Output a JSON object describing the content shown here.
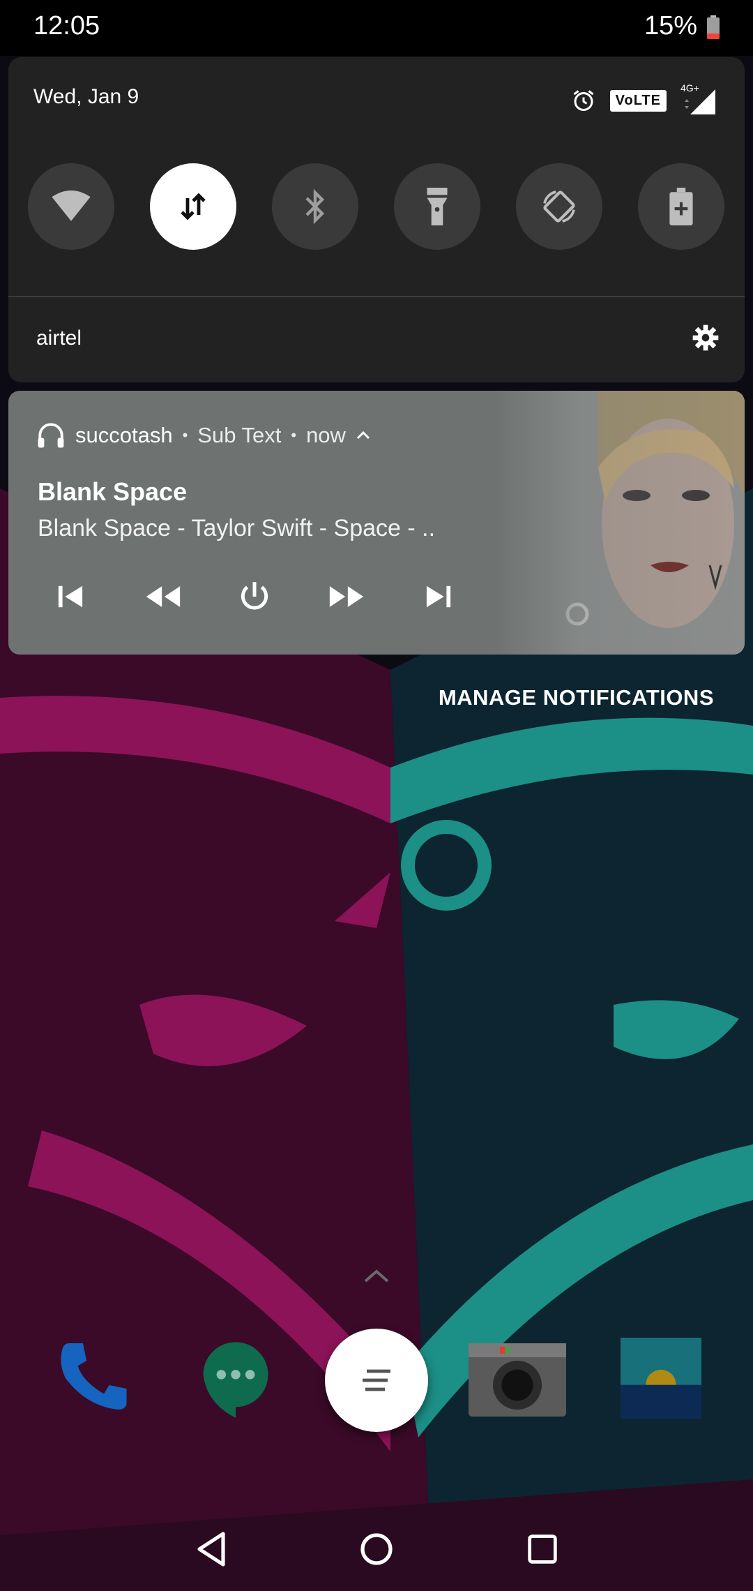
{
  "status_bar": {
    "time": "12:05",
    "battery": "15%"
  },
  "quick_settings": {
    "date": "Wed, Jan 9",
    "volte": "VoLTE",
    "network_type": "4G+",
    "tiles": [
      {
        "name": "wifi-icon",
        "active": false
      },
      {
        "name": "mobile-data-icon",
        "active": true
      },
      {
        "name": "bluetooth-icon",
        "active": false
      },
      {
        "name": "flashlight-icon",
        "active": false
      },
      {
        "name": "auto-rotate-icon",
        "active": false
      },
      {
        "name": "battery-saver-icon",
        "active": false
      }
    ],
    "carrier": "airtel"
  },
  "media_notification": {
    "app_name": "succotash",
    "sub_text": "Sub Text",
    "time": "now",
    "title": "Blank Space",
    "subtitle": "Blank Space - Taylor Swift - Space - ..",
    "controls": [
      "skip-previous-icon",
      "rewind-icon",
      "power-icon",
      "fast-forward-icon",
      "skip-next-icon"
    ]
  },
  "manage_notifications": "MANAGE NOTIFICATIONS",
  "dock": {
    "apps": [
      "phone-icon",
      "hangouts-icon",
      "camera-icon",
      "gallery-icon"
    ],
    "fab_icon": "app-drawer-icon"
  },
  "nav_bar": [
    "back-icon",
    "home-icon",
    "recents-icon"
  ],
  "colors": {
    "panel": "#222222",
    "tile": "#3a3a3a",
    "media_card": "#6e7372",
    "wallpaper_pink": "#8c1358",
    "wallpaper_teal": "#1c8f86"
  }
}
